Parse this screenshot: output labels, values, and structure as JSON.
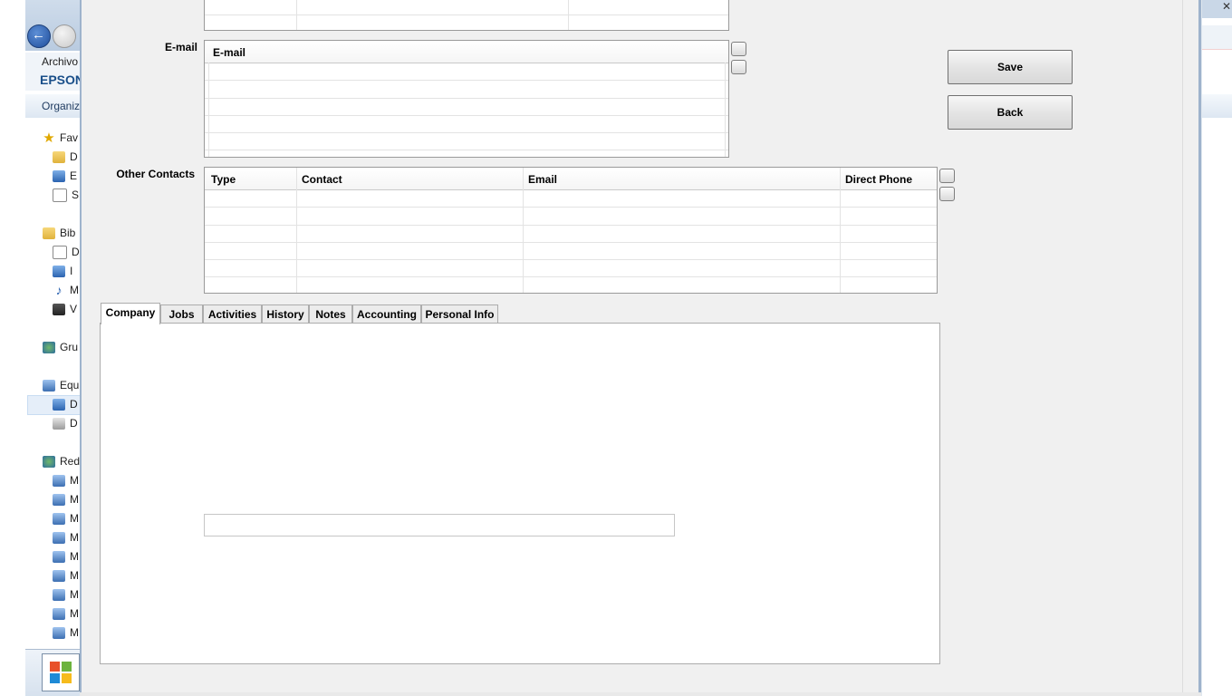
{
  "background_window": {
    "menu_item": "Archivo",
    "breadcrumb": "EPSON",
    "organize_label": "Organiz",
    "nav_items": [
      {
        "label": "Fav",
        "icon": "star-icon"
      },
      {
        "label": "D",
        "icon": "folder-icon"
      },
      {
        "label": "E",
        "icon": "desktop-icon"
      },
      {
        "label": "S",
        "icon": "recent-icon"
      },
      {
        "label": "Bib",
        "icon": "library-icon"
      },
      {
        "label": "D",
        "icon": "document-icon"
      },
      {
        "label": "I",
        "icon": "image-icon"
      },
      {
        "label": "M",
        "icon": "music-icon"
      },
      {
        "label": "V",
        "icon": "video-icon"
      },
      {
        "label": "Gru",
        "icon": "homegroup-icon"
      },
      {
        "label": "Equ",
        "icon": "computer-icon"
      },
      {
        "label": "D",
        "icon": "disk-icon"
      },
      {
        "label": "D",
        "icon": "drive-icon"
      },
      {
        "label": "Red",
        "icon": "network-icon"
      },
      {
        "label": "M",
        "icon": "network-computer-icon"
      },
      {
        "label": "M",
        "icon": "network-computer-icon"
      },
      {
        "label": "M",
        "icon": "network-computer-icon"
      },
      {
        "label": "M",
        "icon": "network-computer-icon"
      },
      {
        "label": "M",
        "icon": "network-computer-icon"
      },
      {
        "label": "M",
        "icon": "network-computer-icon"
      },
      {
        "label": "M",
        "icon": "network-computer-icon"
      },
      {
        "label": "M",
        "icon": "network-computer-icon"
      },
      {
        "label": "M",
        "icon": "network-computer-icon"
      }
    ]
  },
  "form": {
    "email_label": "E-mail",
    "email_grid": {
      "header": "E-mail",
      "rows": [
        "",
        "",
        "",
        "",
        ""
      ]
    },
    "other_contacts_label": "Other Contacts",
    "other_contacts_grid": {
      "columns": [
        "Type",
        "Contact",
        "Email",
        "Direct Phone"
      ],
      "rows": [
        [
          "",
          "",
          "",
          ""
        ],
        [
          "",
          "",
          "",
          ""
        ],
        [
          "",
          "",
          "",
          ""
        ],
        [
          "",
          "",
          "",
          ""
        ],
        [
          "",
          "",
          "",
          ""
        ]
      ]
    }
  },
  "actions": {
    "save": "Save",
    "back": "Back"
  },
  "tabs": [
    {
      "label": "Company",
      "active": true
    },
    {
      "label": "Jobs",
      "active": false
    },
    {
      "label": "Activities",
      "active": false
    },
    {
      "label": "History",
      "active": false
    },
    {
      "label": "Notes",
      "active": false
    },
    {
      "label": "Accounting",
      "active": false
    },
    {
      "label": "Personal Info",
      "active": false
    }
  ],
  "company_panel": {
    "input_value": ""
  }
}
